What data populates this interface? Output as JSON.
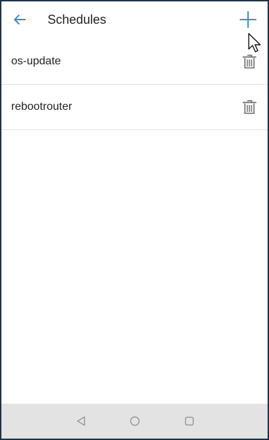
{
  "header": {
    "title": "Schedules",
    "back_icon": "arrow-left-icon",
    "add_icon": "plus-icon"
  },
  "schedules": [
    {
      "name": "os-update",
      "action_icon": "trash-icon"
    },
    {
      "name": "rebootrouter",
      "action_icon": "trash-icon"
    }
  ],
  "navigation": {
    "back_icon": "triangle-back-icon",
    "home_icon": "circle-home-icon",
    "recents_icon": "square-recents-icon"
  },
  "colors": {
    "accent": "#3a8fc9",
    "text": "#222222",
    "icon_gray": "#6b6b6b",
    "divider": "#e0e0e0",
    "nav_bar": "#e3e3e3",
    "frame_border": "#1f3346"
  }
}
